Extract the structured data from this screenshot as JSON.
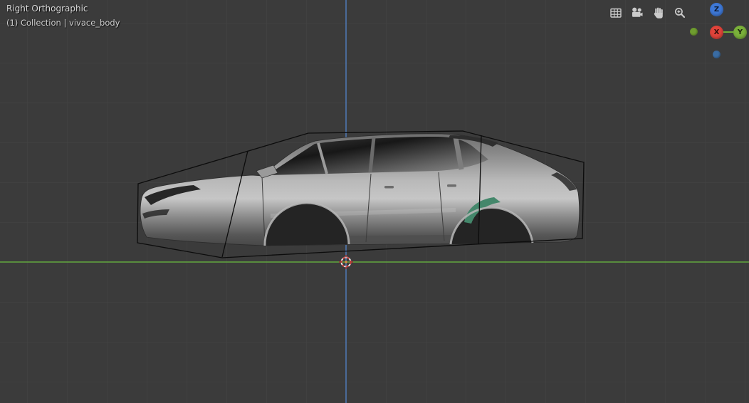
{
  "header": {
    "view_label": "Right Orthographic",
    "breadcrumb": "(1) Collection | vivace_body"
  },
  "toolbar": {
    "icons": [
      {
        "name": "grid-overlay-icon"
      },
      {
        "name": "camera-view-icon"
      },
      {
        "name": "pan-hand-icon"
      },
      {
        "name": "zoom-magnifier-icon"
      }
    ]
  },
  "nav_gizmo": {
    "pos_axes": [
      {
        "label": "Z",
        "color": "#3e78d6"
      },
      {
        "label": "X",
        "color": "#e0433a"
      },
      {
        "label": "Y",
        "color": "#7ab03a"
      }
    ],
    "neg_axes": [
      {
        "name": "neg-y",
        "color": "#6f9d2f"
      },
      {
        "name": "neg-z",
        "color": "#3a6ca3"
      }
    ]
  },
  "scene": {
    "object_name": "vivace_body",
    "y_axis_line_color": "#62a83e",
    "z_axis_line_color": "#4f77b0",
    "grid_color": "#444444",
    "background_color": "#3b3b3b"
  }
}
